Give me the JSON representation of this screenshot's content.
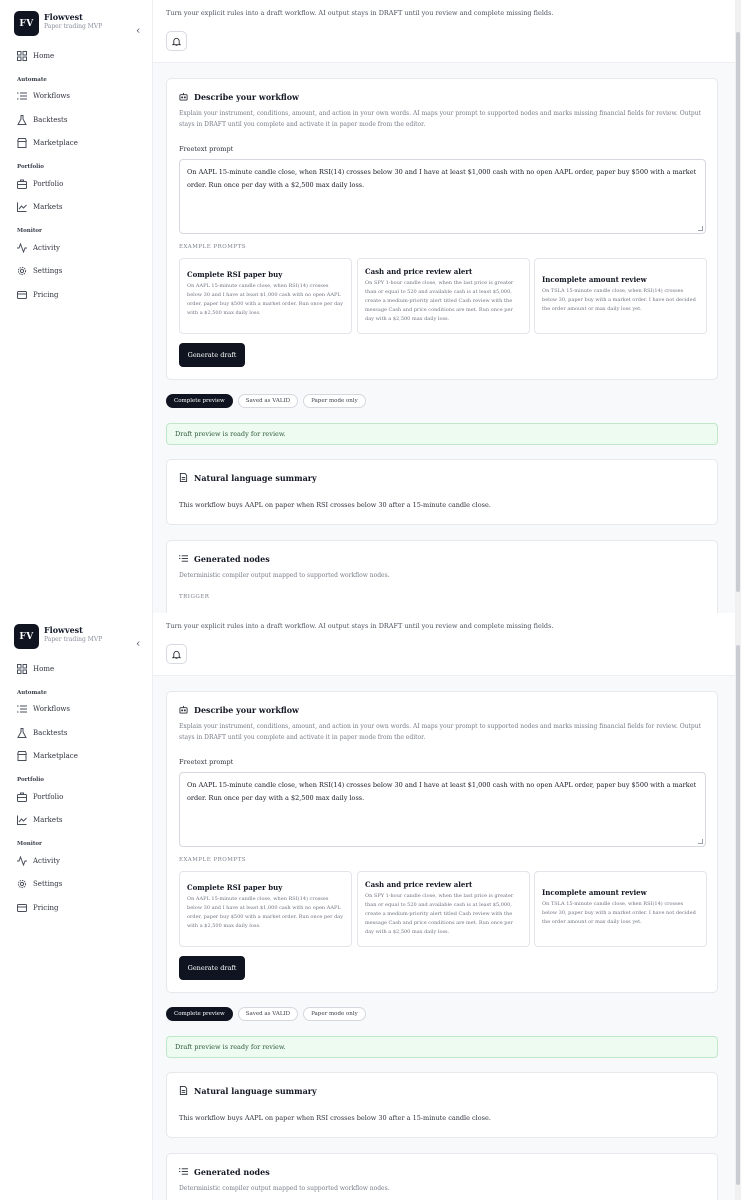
{
  "brand": {
    "logo": "FV",
    "name": "Flowvest",
    "subtitle": "Paper trading MVP",
    "collapse_icon": "chevron-left-icon"
  },
  "nav": {
    "home": "Home",
    "sections": {
      "automate": "Automate",
      "portfolio": "Portfolio",
      "monitor": "Monitor"
    },
    "workflows": "Workflows",
    "backtests": "Backtests",
    "marketplace": "Marketplace",
    "portfolio": "Portfolio",
    "markets": "Markets",
    "activity": "Activity",
    "settings": "Settings",
    "pricing": "Pricing"
  },
  "header": {
    "text": "Turn your explicit rules into a draft workflow. AI output stays in DRAFT until you review and complete missing fields."
  },
  "describe": {
    "title": "Describe your workflow",
    "description": "Explain your instrument, conditions, amount, and action in your own words. AI maps your prompt to supported nodes and marks missing financial fields for review. Output stays in DRAFT until you complete and activate it in paper mode from the editor.",
    "field_label": "Freetext prompt",
    "prompt_value": "On AAPL 15-minute candle close, when RSI(14) crosses below 30 and I have at least $1,000 cash with no open AAPL order, paper buy $500 with a market order. Run once per day with a $2,500 max daily loss.",
    "examples_label": "EXAMPLE PROMPTS",
    "examples": [
      {
        "title": "Complete RSI paper buy",
        "text": "On AAPL 15-minute candle close, when RSI(14) crosses below 30 and I have at least $1,000 cash with no open AAPL order, paper buy $500 with a market order. Run once per day with a $2,500 max daily loss."
      },
      {
        "title": "Cash and price review alert",
        "text": "On SPY 1-hour candle close, when the last price is greater than or equal to 520 and available cash is at least $5,000, create a medium-priority alert titled Cash review with the message Cash and price conditions are met. Run once per day with a $2,500 max daily loss."
      },
      {
        "title": "Incomplete amount review",
        "text": "On TSLA 15-minute candle close, when RSI(14) crosses below 30, paper buy with a market order. I have not decided the order amount or max daily loss yet."
      }
    ],
    "generate_button": "Generate draft"
  },
  "status_pills": {
    "preview": "Complete preview",
    "saved": "Saved as VALID",
    "paper": "Paper mode only"
  },
  "ready_banner": "Draft preview is ready for review.",
  "summary": {
    "title": "Natural language summary",
    "text": "This workflow buys AAPL on paper when RSI crosses below 30 after a 15-minute candle close."
  },
  "nodes": {
    "title": "Generated nodes",
    "description": "Deterministic compiler output mapped to supported workflow nodes.",
    "trigger_label": "TRIGGER"
  },
  "colors": {
    "primary": "#0f1420",
    "success_bg": "#eefbf1",
    "success_border": "#bfe8cb",
    "main_bg": "#f8f9fa"
  }
}
